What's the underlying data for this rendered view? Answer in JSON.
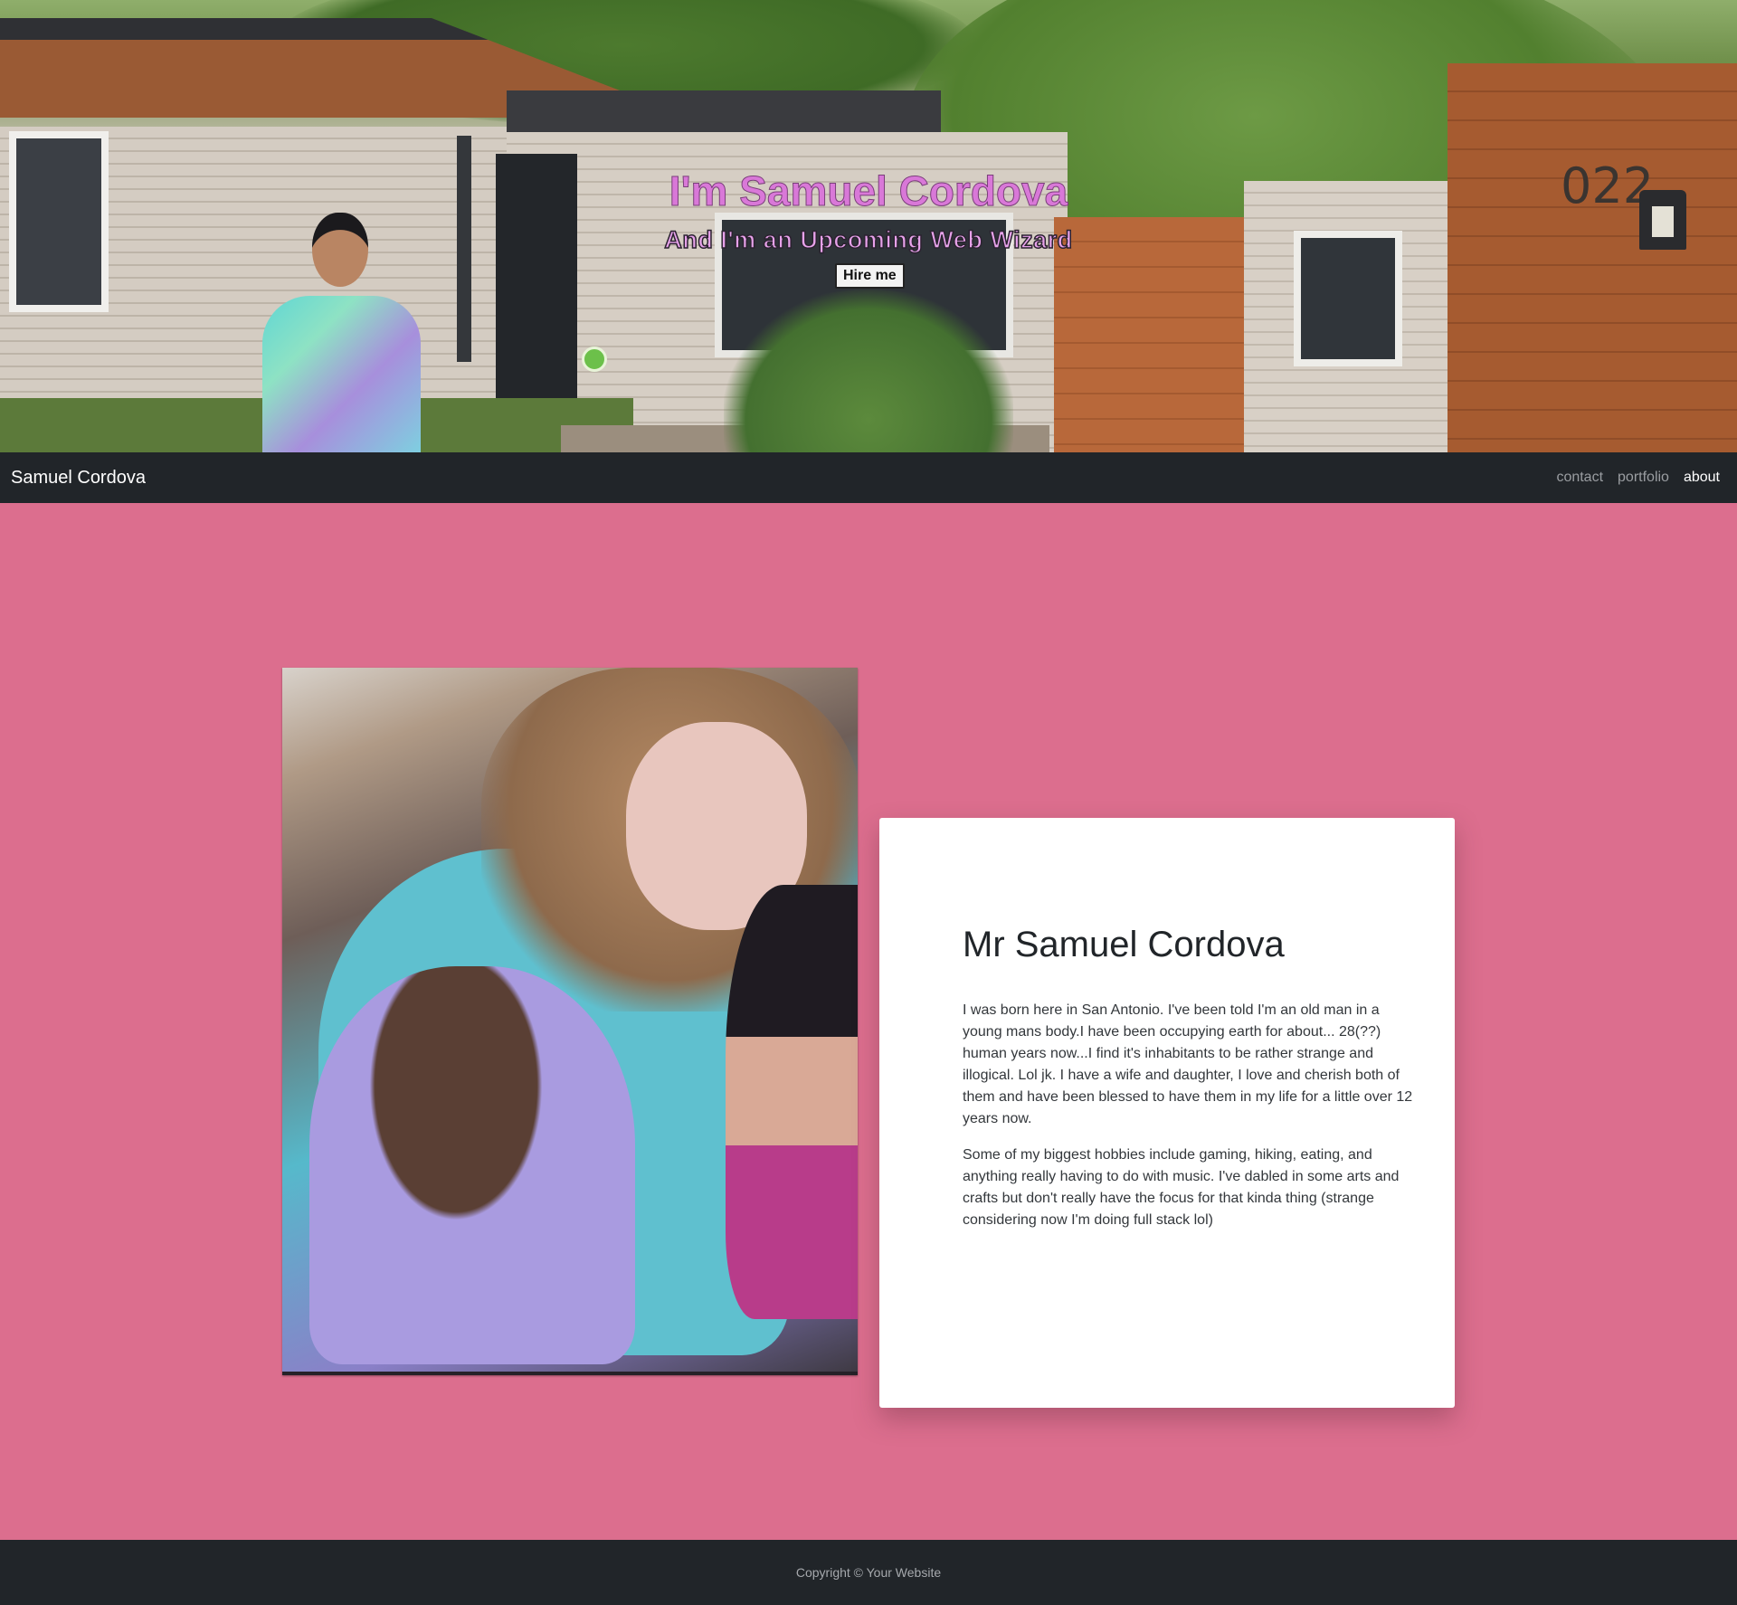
{
  "hero": {
    "title": "I'm Samuel Cordova",
    "subtitle": "And I'm an Upcoming Web Wizard",
    "hire_button": "Hire me",
    "house_number": "022",
    "title_color": "#d978d8",
    "subtitle_color": "#e7a2ea"
  },
  "navbar": {
    "brand": "Samuel Cordova",
    "links": [
      {
        "label": "contact",
        "active": false
      },
      {
        "label": "portfolio",
        "active": false
      },
      {
        "label": "about",
        "active": true
      }
    ],
    "background": "#212529"
  },
  "about": {
    "heading": "Mr Samuel Cordova",
    "paragraphs": [
      "I was born here in San Antonio. I've been told I'm an old man in a young mans body.I have been occupying earth for about... 28(??) human years now...I find it's inhabitants to be rather strange and illogical. Lol jk. I have a wife and daughter, I love and cherish both of them and have been blessed to have them in my life for a little over 12 years now.",
      "Some of my biggest hobbies include gaming, hiking, eating, and anything really having to do with music. I've dabled in some arts and crafts but don't really have the focus for that kinda thing (strange considering now I'm doing full stack lol)"
    ],
    "background": "#dc6e8e"
  },
  "footer": {
    "copyright": "Copyright © Your Website"
  }
}
